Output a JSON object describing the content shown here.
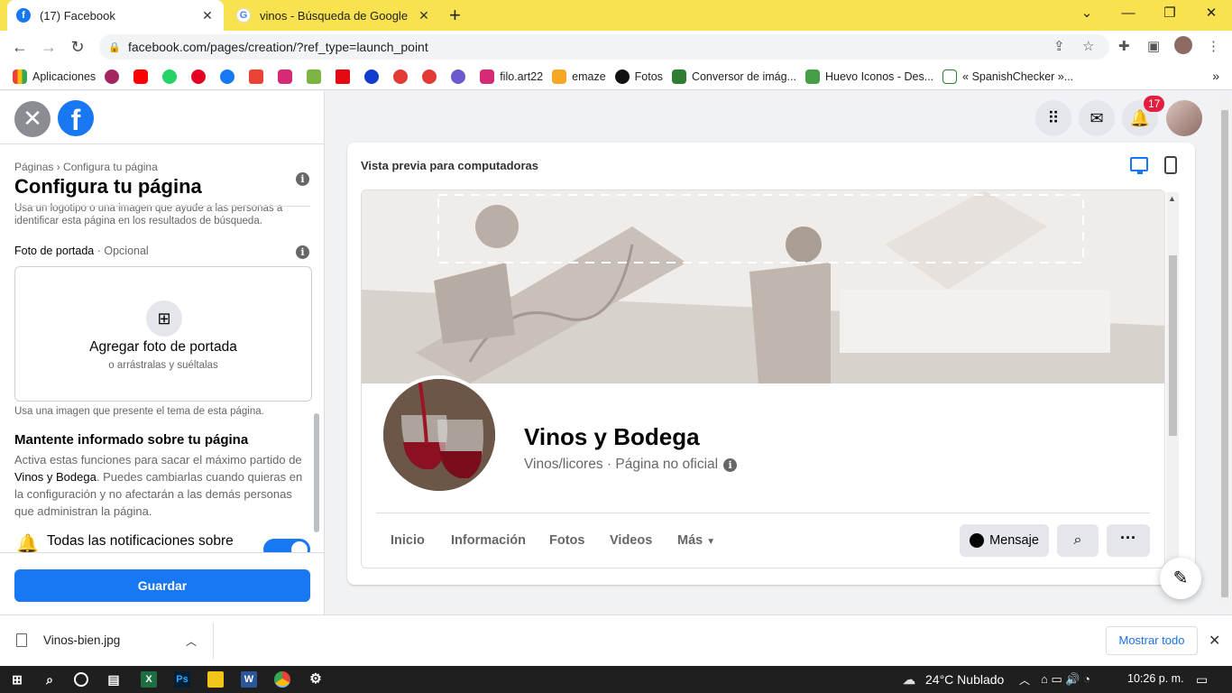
{
  "browser": {
    "tabs": [
      {
        "title": "(17) Facebook",
        "favicon": "facebook-icon"
      },
      {
        "title": "vinos - Búsqueda de Google",
        "favicon": "google-icon"
      }
    ],
    "url": "facebook.com/pages/creation/?ref_type=launch_point",
    "bookmarks": [
      "Aplicaciones",
      "filo.art22",
      "emaze",
      "Fotos",
      "Conversor de imág...",
      "Huevo Iconos - Des...",
      "« SpanishChecker »..."
    ]
  },
  "left_panel": {
    "breadcrumb": "Páginas › Configura tu página",
    "title": "Configura tu página",
    "logo_help": "Usa un logotipo o una imagen que ayude a las personas a identificar esta página en los resultados de búsqueda.",
    "cover_label": "Foto de portada",
    "cover_optional": " · Opcional",
    "cover_add_title": "Agregar foto de portada",
    "cover_add_sub": "o arrástralas y suéltalas",
    "cover_help": "Usa una imagen que presente el tema de esta página.",
    "notify_title": "Mantente informado sobre tu página",
    "notify_body_1": "Activa estas funciones para sacar el máximo partido de ",
    "notify_body_page": "Vinos y Bodega",
    "notify_body_2": ". Puedes cambiarlas cuando quieras en la configuración y no afectarán a las demás personas que administran la página.",
    "notify_row": "Todas las notificaciones sobre",
    "notify_toggle_on": true,
    "save_label": "Guardar"
  },
  "header": {
    "notifications_badge": "17"
  },
  "preview": {
    "title": "Vista previa para computadoras",
    "page_name": "Vinos y Bodega",
    "page_category": "Vinos/licores · Página no oficial",
    "tabs": [
      "Inicio",
      "Información",
      "Fotos",
      "Videos",
      "Más"
    ],
    "message_label": "Mensaje",
    "more_label": "···"
  },
  "downloads": {
    "file": "Vinos-bien.jpg",
    "show_all": "Mostrar todo"
  },
  "taskbar": {
    "weather": "24°C  Nublado",
    "time": "10:26 p. m."
  },
  "colors": {
    "facebook_blue": "#1877f2",
    "chrome_tabstrip": "#f8e24f",
    "badge_red": "#e41e3f"
  }
}
